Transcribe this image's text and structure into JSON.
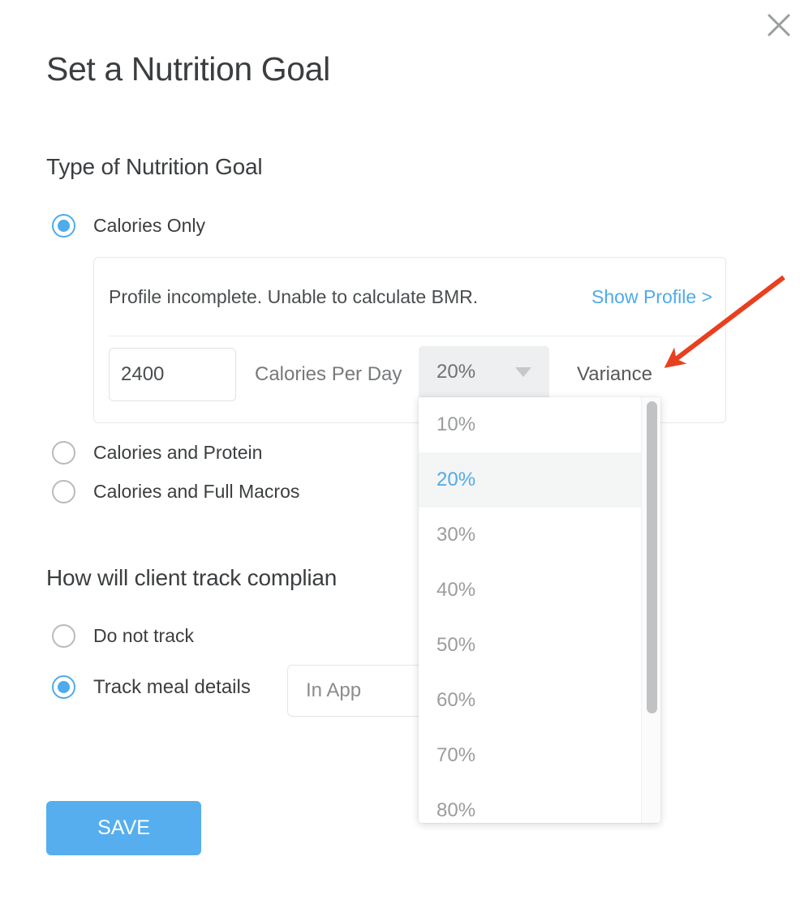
{
  "dialog": {
    "title": "Set a Nutrition Goal",
    "close_icon": "close-icon"
  },
  "type_section": {
    "heading": "Type of Nutrition Goal",
    "options": [
      {
        "label": "Calories Only",
        "selected": true
      },
      {
        "label": "Calories and Protein",
        "selected": false
      },
      {
        "label": "Calories and Full Macros",
        "selected": false
      }
    ]
  },
  "calories_panel": {
    "notice": "Profile incomplete. Unable to calculate BMR.",
    "profile_link": "Show Profile >",
    "calories_value": "2400",
    "calories_placeholder": "2400",
    "calories_unit_label": "Calories Per Day",
    "variance_label": "Variance",
    "variance_selected": "20%",
    "variance_caret_icon": "chevron-down-icon",
    "variance_options": [
      "10%",
      "20%",
      "30%",
      "40%",
      "50%",
      "60%",
      "70%",
      "80%"
    ]
  },
  "track_section": {
    "heading": "How will client track complian",
    "options": [
      {
        "label": "Do not track",
        "selected": false
      },
      {
        "label": "Track meal details",
        "selected": true
      }
    ],
    "method_value": "In App"
  },
  "footer": {
    "save_label": "SAVE"
  },
  "annotation": {
    "arrow_color": "#e8401f",
    "arrow_target": "Variance"
  },
  "colors": {
    "accent_blue": "#4fabe9",
    "save_blue": "#56aeee",
    "text_dark": "#3b3e40",
    "text_muted": "#9a9c9e"
  }
}
